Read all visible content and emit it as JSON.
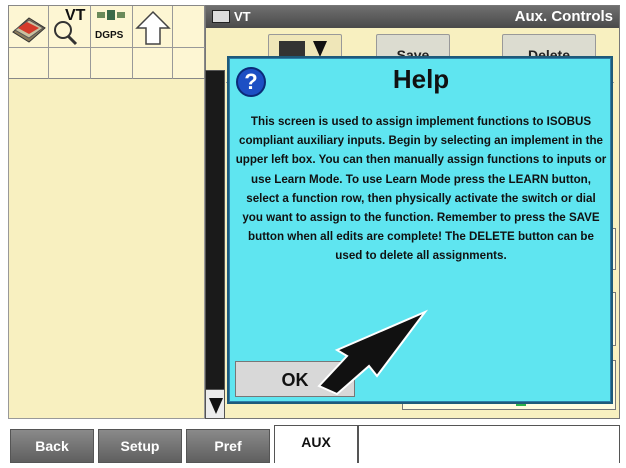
{
  "vt_window": {
    "title": "VT",
    "screen_title": "Aux. Controls",
    "bg_buttons": {
      "save": "Save",
      "delete": "Delete"
    }
  },
  "icon_strip": {
    "vt_icon_label": "VT",
    "dgps_label": "DGPS"
  },
  "help_dialog": {
    "title": "Help",
    "body": "This screen is used to assign implement functions to ISOBUS compliant auxiliary inputs. Begin by selecting an implement in the upper left box. You can then manually assign functions to inputs or use Learn Mode. To use Learn Mode press the LEARN button, select a function row, then physically activate the switch or dial you want to assign to the function. Remember to press the SAVE button when all edits are complete! The DELETE button can be used to delete all assignments.",
    "ok_label": "OK"
  },
  "tabs": [
    {
      "label": "Back"
    },
    {
      "label": "Setup"
    },
    {
      "label": "Pref"
    },
    {
      "label": "AUX"
    }
  ],
  "colors": {
    "dialog_bg": "#5fe5f0",
    "panel_bg": "#f8f0c0",
    "help_icon": "#1d4fc4"
  }
}
